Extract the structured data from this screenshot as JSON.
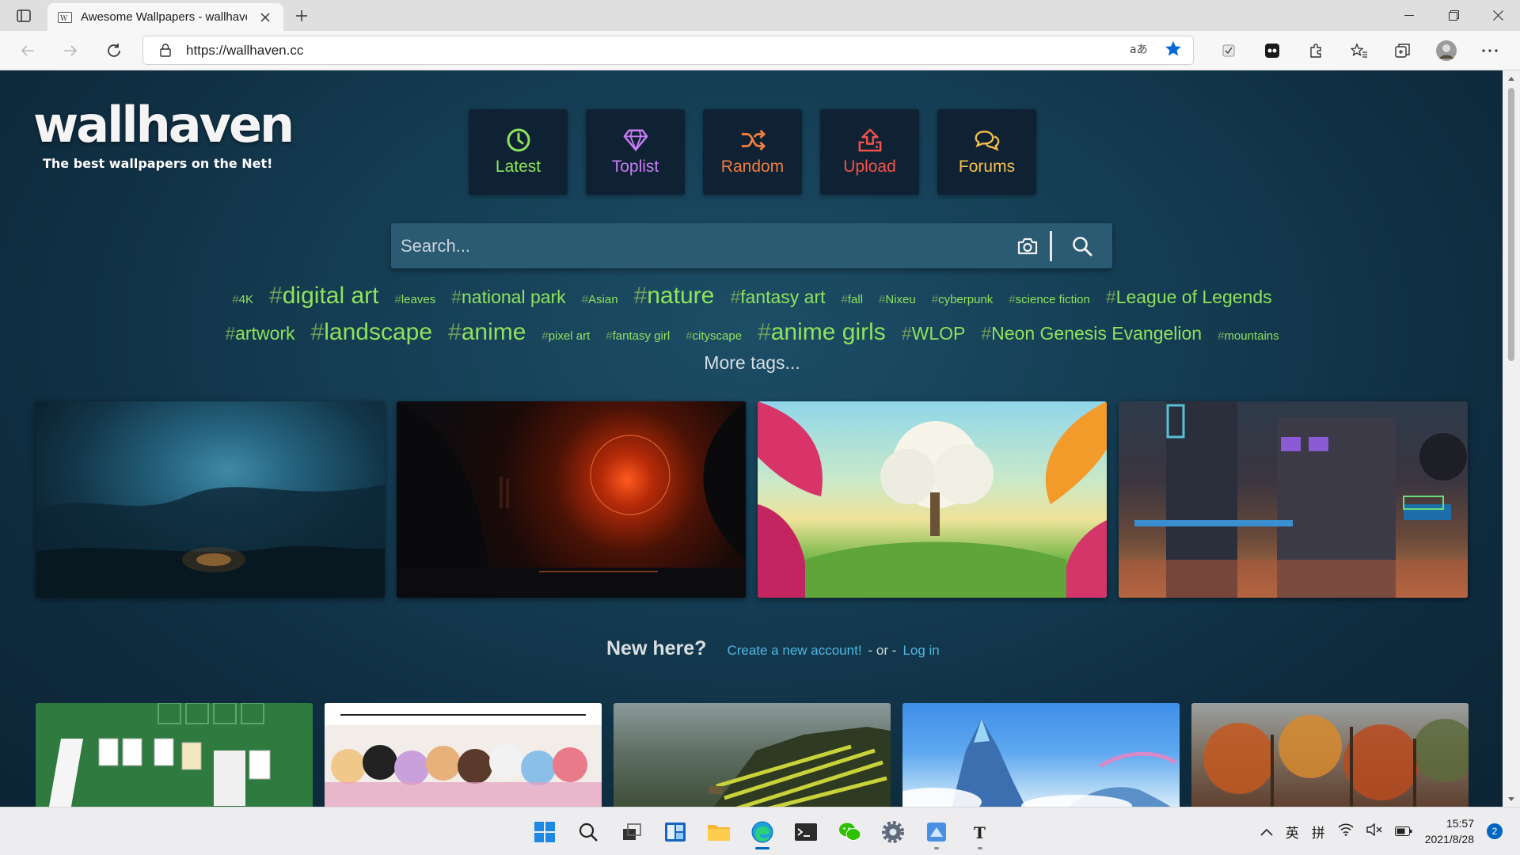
{
  "browser": {
    "tab_title": "Awesome Wallpapers - wallhaven",
    "url": "https://wallhaven.cc"
  },
  "site": {
    "logo": "wallhaven",
    "tagline": "The best wallpapers on the Net!",
    "nav": [
      {
        "label": "Latest",
        "icon": "clock-icon",
        "color": "#8fe35b"
      },
      {
        "label": "Toplist",
        "icon": "diamond-icon",
        "color": "#c77df3"
      },
      {
        "label": "Random",
        "icon": "shuffle-icon",
        "color": "#f27c3e"
      },
      {
        "label": "Upload",
        "icon": "upload-icon",
        "color": "#f5514b"
      },
      {
        "label": "Forums",
        "icon": "chat-icon",
        "color": "#f6c04c"
      }
    ],
    "search": {
      "placeholder": "Search..."
    },
    "tags_row1": [
      "4K",
      "digital art",
      "leaves",
      "national park",
      "Asian",
      "nature",
      "fantasy art",
      "fall",
      "Nixeu",
      "cyberpunk",
      "science fiction",
      "League of Legends"
    ],
    "tags_row2": [
      "artwork",
      "landscape",
      "anime",
      "pixel art",
      "fantasy girl",
      "cityscape",
      "anime girls",
      "WLOP",
      "Neon Genesis Evangelion",
      "mountains"
    ],
    "more_tags": "More tags...",
    "new_here": {
      "title": "New here?",
      "create_link": "Create a new account!",
      "or": "- or -",
      "login_link": "Log in"
    }
  },
  "taskbar": {
    "ime1": "英",
    "ime2": "拼",
    "time": "15:57",
    "date": "2021/8/28",
    "notifications": "2"
  }
}
